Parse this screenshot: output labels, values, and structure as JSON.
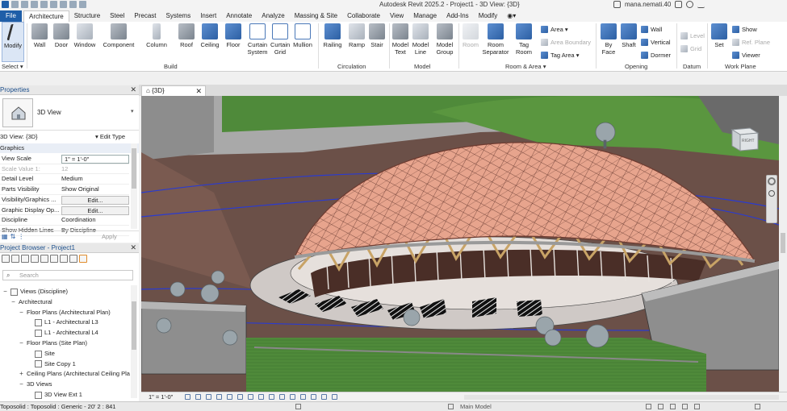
{
  "window": {
    "title": "Autodesk Revit 2025.2 - Project1 - 3D View: {3D}",
    "user": "mana.nemati.40"
  },
  "tabs": [
    {
      "label": "File",
      "state": "file"
    },
    {
      "label": "Architecture",
      "state": "active"
    },
    {
      "label": "Structure"
    },
    {
      "label": "Steel"
    },
    {
      "label": "Precast"
    },
    {
      "label": "Systems"
    },
    {
      "label": "Insert"
    },
    {
      "label": "Annotate"
    },
    {
      "label": "Analyze"
    },
    {
      "label": "Massing & Site"
    },
    {
      "label": "Collaborate"
    },
    {
      "label": "View"
    },
    {
      "label": "Manage"
    },
    {
      "label": "Add-Ins"
    },
    {
      "label": "Modify"
    }
  ],
  "ribbon": {
    "select": {
      "modify": "Modify",
      "select": "Select ▾",
      "panel": ""
    },
    "build": {
      "panel": "Build",
      "wall": "Wall",
      "door": "Door",
      "window": "Window",
      "component": "Component",
      "column": "Column",
      "roof": "Roof",
      "ceiling": "Ceiling",
      "floor": "Floor",
      "curtain_system": "Curtain System",
      "curtain_grid": "Curtain Grid",
      "mullion": "Mullion"
    },
    "circulation": {
      "panel": "Circulation",
      "railing": "Railing",
      "ramp": "Ramp",
      "stair": "Stair"
    },
    "model": {
      "panel": "Model",
      "model_text": "Model Text",
      "model_line": "Model Line",
      "model_group": "Model Group"
    },
    "room_area": {
      "panel": "Room & Area ▾",
      "room": "Room",
      "room_separator": "Room Separator",
      "tag_room": "Tag Room",
      "area": "Area ▾",
      "area_boundary": "Area Boundary",
      "tag_area": "Tag Area ▾"
    },
    "opening": {
      "panel": "Opening",
      "by_face": "By Face",
      "shaft": "Shaft",
      "wall": "Wall",
      "vertical": "Vertical",
      "dormer": "Dormer"
    },
    "datum": {
      "panel": "Datum",
      "level": "Level",
      "grid": "Grid"
    },
    "work_plane": {
      "panel": "Work Plane",
      "set": "Set",
      "show": "Show",
      "ref_plane": "Ref. Plane",
      "viewer": "Viewer"
    }
  },
  "properties": {
    "title": "Properties",
    "type_name": "3D View",
    "instance": "3D View: {3D}",
    "edit_type": "Edit Type",
    "category": "Graphics",
    "rows": [
      {
        "k": "View Scale",
        "v": "1\" = 1'-0\"",
        "kind": "box"
      },
      {
        "k": "Scale Value    1:",
        "v": "12",
        "kind": "dim"
      },
      {
        "k": "Detail Level",
        "v": "Medium"
      },
      {
        "k": "Parts Visibility",
        "v": "Show Original"
      },
      {
        "k": "Visibility/Graphics ...",
        "v": "Edit...",
        "kind": "btn"
      },
      {
        "k": "Graphic Display Op...",
        "v": "Edit...",
        "kind": "btn"
      },
      {
        "k": "Discipline",
        "v": "Coordination"
      },
      {
        "k": "Show Hidden Lines",
        "v": "By Discipline"
      }
    ],
    "apply": "Apply"
  },
  "browser": {
    "title": "Project Browser - Project1",
    "search_placeholder": "Search",
    "items": [
      {
        "label": "Views (Discipline)",
        "toggle": "−",
        "indent": 0,
        "icon": true
      },
      {
        "label": "Architectural",
        "toggle": "−",
        "indent": 1
      },
      {
        "label": "Floor Plans (Architectural Plan)",
        "toggle": "−",
        "indent": 2
      },
      {
        "label": "L1 - Architectural L3",
        "indent": 3,
        "icon": true
      },
      {
        "label": "L1 - Architectural L4",
        "indent": 3,
        "icon": true
      },
      {
        "label": "Floor Plans (Site Plan)",
        "toggle": "−",
        "indent": 2
      },
      {
        "label": "Site",
        "indent": 3,
        "icon": true
      },
      {
        "label": "Site Copy 1",
        "indent": 3,
        "icon": true
      },
      {
        "label": "Ceiling Plans (Architectural Ceiling Pla",
        "toggle": "+",
        "indent": 2
      },
      {
        "label": "3D Views",
        "toggle": "−",
        "indent": 2
      },
      {
        "label": "3D View Ext 1",
        "indent": 3,
        "icon": true
      }
    ]
  },
  "view_tab": {
    "label": "{3D}"
  },
  "viewcube": {
    "face": "RIGHT"
  },
  "view_control": {
    "scale": "1\" = 1'-0\""
  },
  "status": {
    "text": "Toposolid : Toposolid : Generic - 20' 2 : 841",
    "model": "Main Model"
  },
  "colors": {
    "accent": "#1f5ea8",
    "roof": "#e7a48d",
    "grass": "#4f8a3a",
    "soil": "#6b5048"
  }
}
